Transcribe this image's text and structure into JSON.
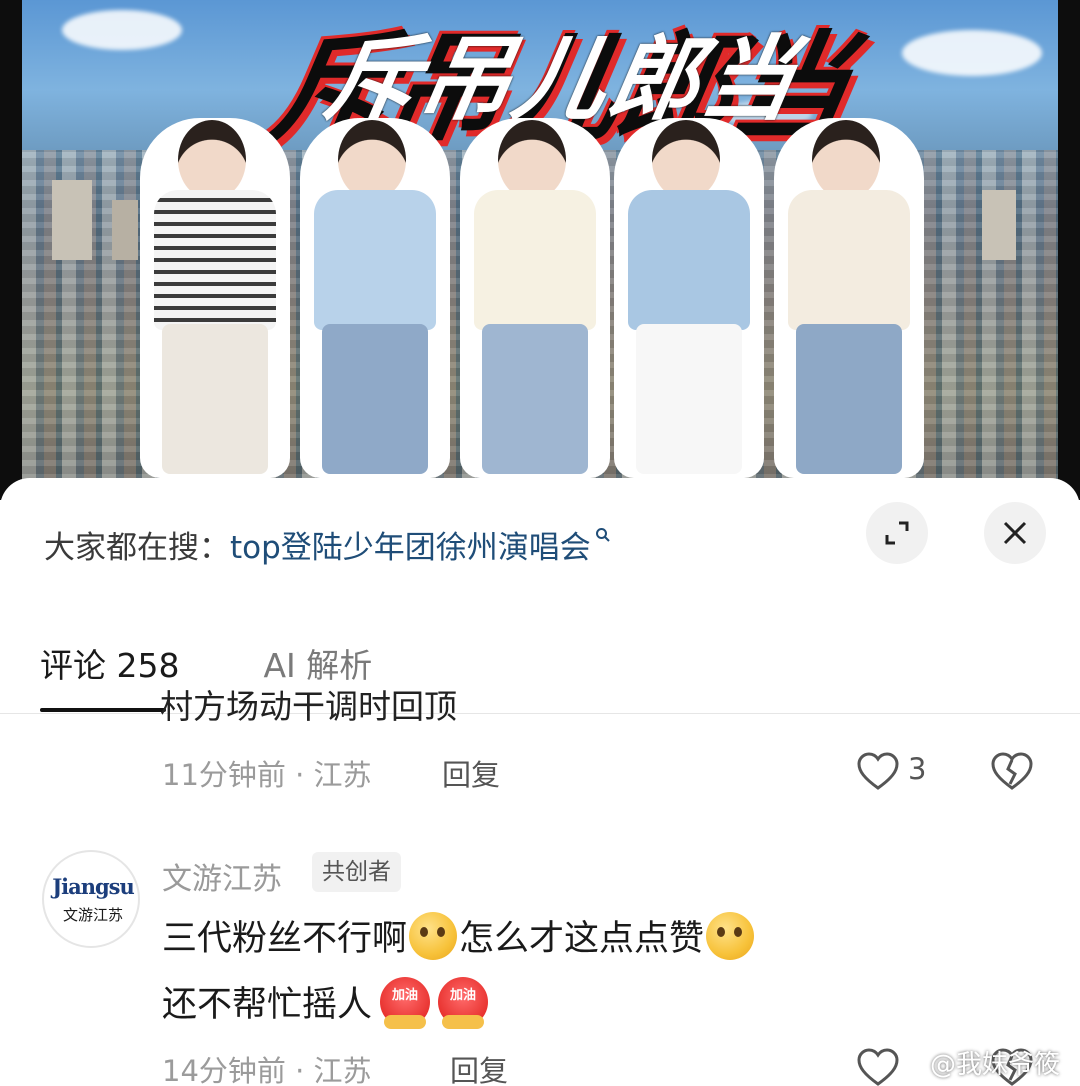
{
  "video": {
    "poster_title": "斥吊儿郎当"
  },
  "search": {
    "prefix": "大家都在搜：",
    "term": "top登陆少年团徐州演唱会",
    "icon": "search-icon"
  },
  "controls": {
    "expand_icon": "expand-icon",
    "close_icon": "close-icon"
  },
  "tabs": {
    "comments_label": "评论 258",
    "ai_label": "AI 解析"
  },
  "comments": [
    {
      "clipped_text": "村方场动干调时回顶",
      "time": "11分钟前 · 江苏",
      "reply": "回复",
      "likes": "3"
    },
    {
      "author": "文游江苏",
      "badge": "共创者",
      "avatar_text_top": "Jiangsu",
      "avatar_text_bottom": "文游江苏",
      "line1_a": "三代粉丝不行啊",
      "line1_b": "怎么才这点点赞",
      "line2": "还不帮忙摇人",
      "emoji_jiayou": "加油",
      "time": "14分钟前 · 江苏",
      "reply": "回复"
    }
  ],
  "watermark": "@我妹爷筱",
  "colors": {
    "link": "#1f4d78",
    "muted": "#9b9b9b",
    "poster_red": "#e02a2a"
  }
}
